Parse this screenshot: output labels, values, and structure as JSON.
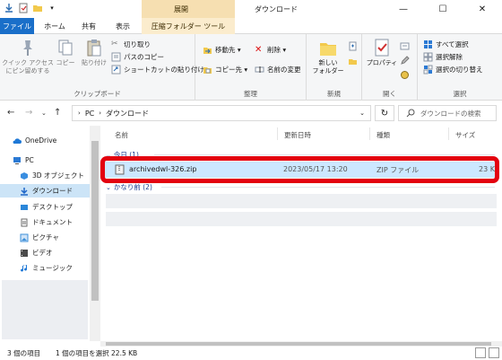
{
  "window": {
    "title": "ダウンロード",
    "context_tab_header": "展開",
    "controls": {
      "minimize": "—",
      "maximize": "☐",
      "close": "✕"
    }
  },
  "ribbon_tabs": {
    "file": "ファイル",
    "home": "ホーム",
    "share": "共有",
    "view": "表示",
    "compressed_tools": "圧縮フォルダー ツール"
  },
  "ribbon": {
    "clipboard": {
      "label": "クリップボード",
      "pin": "クイック アクセス\nにピン留めする",
      "copy": "コピー",
      "paste": "貼り付け",
      "cut": "切り取り",
      "copy_path": "パスのコピー",
      "paste_shortcut": "ショートカットの貼り付け"
    },
    "organize": {
      "label": "整理",
      "move_to": "移動先 ▾",
      "copy_to": "コピー先 ▾",
      "delete": "削除 ▾",
      "rename": "名前の変更"
    },
    "new": {
      "label": "新規",
      "new_folder": "新しい\nフォルダー"
    },
    "open": {
      "label": "開く",
      "properties": "プロパティ"
    },
    "select": {
      "label": "選択",
      "select_all": "すべて選択",
      "select_none": "選択解除",
      "invert": "選択の切り替え"
    }
  },
  "address": {
    "path": [
      "PC",
      "ダウンロード"
    ],
    "search_placeholder": "ダウンロードの検索"
  },
  "nav": {
    "items": [
      {
        "label": "OneDrive",
        "icon": "cloud-icon",
        "color": "#1e78d6"
      },
      {
        "label": "PC",
        "icon": "computer-icon",
        "color": "#2b7ad4"
      },
      {
        "label": "3D オブジェクト",
        "icon": "cube-icon",
        "color": "#3a8ee0"
      },
      {
        "label": "ダウンロード",
        "icon": "download-icon",
        "color": "#1e66c9",
        "selected": true
      },
      {
        "label": "デスクトップ",
        "icon": "desktop-icon",
        "color": "#2a86d9"
      },
      {
        "label": "ドキュメント",
        "icon": "document-icon",
        "color": "#6a6a6a"
      },
      {
        "label": "ピクチャ",
        "icon": "picture-icon",
        "color": "#3d8fd8"
      },
      {
        "label": "ビデオ",
        "icon": "video-icon",
        "color": "#4a4a4a"
      },
      {
        "label": "ミュージック",
        "icon": "music-icon",
        "color": "#1e78d6"
      }
    ]
  },
  "columns": [
    "名前",
    "更新日時",
    "種類",
    "サイズ"
  ],
  "groups": {
    "today": "今日 (1)",
    "long_ago": "かなり前 (2)"
  },
  "files": [
    {
      "name": "archivedwl-326.zip",
      "modified": "2023/05/17 13:20",
      "type": "ZIP ファイル",
      "size": "23 K",
      "selected": true
    }
  ],
  "status": {
    "count": "3 個の項目",
    "selection": "1 個の項目を選択 22.5 KB"
  },
  "colors": {
    "accent": "#1a6fc9",
    "selection": "#cce8ff",
    "highlight_box": "#e3000f",
    "context_tab": "#f6dfb1"
  }
}
